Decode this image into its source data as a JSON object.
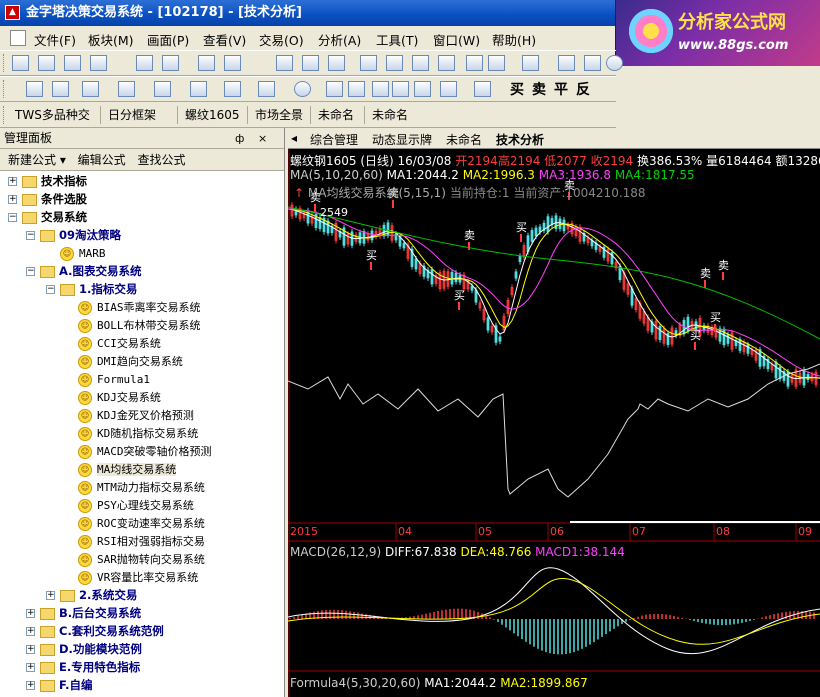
{
  "window": {
    "title": "金字塔决策交易系统 - [102178] - [技术分析]",
    "app_icon": "pyramid-icon"
  },
  "logo": {
    "name": "分析家公式网",
    "url": "www.88gs.com"
  },
  "menu": [
    "文件(F)",
    "板块(M)",
    "画面(P)",
    "查看(V)",
    "交易(O)",
    "分析(A)",
    "工具(T)",
    "窗口(W)",
    "帮助(H)"
  ],
  "toolbar2_text": [
    "买",
    "卖",
    "平",
    "反"
  ],
  "toolbar3_tabs": [
    "TWS多品种交",
    "日分框架",
    "螺纹1605",
    "市场全景",
    "未命名",
    "未命名"
  ],
  "panel": {
    "title": "管理面板",
    "pin": "ф",
    "close": "×",
    "tools": [
      "新建公式 ▾",
      "编辑公式",
      "查找公式"
    ],
    "tree": [
      {
        "level": 0,
        "exp": "+",
        "type": "folder",
        "label": "技术指标"
      },
      {
        "level": 0,
        "exp": "+",
        "type": "folder",
        "label": "条件选股"
      },
      {
        "level": 0,
        "exp": "−",
        "type": "folder",
        "label": "交易系统"
      },
      {
        "level": 1,
        "exp": "−",
        "type": "folder",
        "label": "09淘汰策略"
      },
      {
        "level": 2,
        "exp": "",
        "type": "face",
        "label": "MARB"
      },
      {
        "level": 1,
        "exp": "−",
        "type": "folder",
        "label": "A.图表交易系统"
      },
      {
        "level": 2,
        "exp": "−",
        "type": "folder",
        "label": "1.指标交易"
      },
      {
        "level": 3,
        "exp": "",
        "type": "face",
        "label": "BIAS乖离率交易系统"
      },
      {
        "level": 3,
        "exp": "",
        "type": "face",
        "label": "BOLL布林带交易系统"
      },
      {
        "level": 3,
        "exp": "",
        "type": "face",
        "label": "CCI交易系统"
      },
      {
        "level": 3,
        "exp": "",
        "type": "face",
        "label": "DMI趋向交易系统"
      },
      {
        "level": 3,
        "exp": "",
        "type": "face",
        "label": "Formula1"
      },
      {
        "level": 3,
        "exp": "",
        "type": "face",
        "label": "KDJ交易系统"
      },
      {
        "level": 3,
        "exp": "",
        "type": "face",
        "label": "KDJ金死叉价格预测"
      },
      {
        "level": 3,
        "exp": "",
        "type": "face",
        "label": "KD随机指标交易系统"
      },
      {
        "level": 3,
        "exp": "",
        "type": "face",
        "label": "MACD突破零轴价格预测"
      },
      {
        "level": 3,
        "exp": "",
        "type": "face",
        "label": "MA均线交易系统",
        "selected": true
      },
      {
        "level": 3,
        "exp": "",
        "type": "face",
        "label": "MTM动力指标交易系统"
      },
      {
        "level": 3,
        "exp": "",
        "type": "face",
        "label": "PSY心理线交易系统"
      },
      {
        "level": 3,
        "exp": "",
        "type": "face",
        "label": "ROC变动速率交易系统"
      },
      {
        "level": 3,
        "exp": "",
        "type": "face",
        "label": "RSI相对强弱指标交易"
      },
      {
        "level": 3,
        "exp": "",
        "type": "face",
        "label": "SAR抛物转向交易系统"
      },
      {
        "level": 3,
        "exp": "",
        "type": "face",
        "label": "VR容量比率交易系统"
      },
      {
        "level": 2,
        "exp": "+",
        "type": "folder",
        "label": "2.系统交易"
      },
      {
        "level": 1,
        "exp": "+",
        "type": "folder",
        "label": "B.后台交易系统"
      },
      {
        "level": 1,
        "exp": "+",
        "type": "folder",
        "label": "C.套利交易系统范例"
      },
      {
        "level": 1,
        "exp": "+",
        "type": "folder",
        "label": "D.功能模块范例"
      },
      {
        "level": 1,
        "exp": "+",
        "type": "folder",
        "label": "E.专用特色指标"
      },
      {
        "level": 1,
        "exp": "+",
        "type": "folder",
        "label": "F.自编"
      }
    ]
  },
  "doc_tabs": [
    {
      "label": "综合管理",
      "active": false
    },
    {
      "label": "动态显示牌",
      "active": false
    },
    {
      "label": "未命名",
      "active": false
    },
    {
      "label": "技术分析",
      "active": true
    }
  ],
  "chart": {
    "header": {
      "symbol": "螺纹钢1605 (日线) 16/03/08",
      "open": "开2194",
      "high": "高2194",
      "low": "低2077",
      "close": "收2194",
      "turnover": "换386.53%",
      "volume": "量6184464",
      "amount": "额13286"
    },
    "ma_line": {
      "label": "MA(5,10,20,60)",
      "ma1": "MA1:2044.2",
      "ma2": "MA2:1996.3",
      "ma3": "MA3:1936.8",
      "ma4": "MA4:1817.55"
    },
    "system_line": {
      "label": "MA均线交易系统(5,15,1)",
      "hold": "当前持仓:1",
      "asset": "当前资产:1004210.188"
    },
    "price_label": "2549",
    "x_labels": [
      "2015",
      "04",
      "05",
      "06",
      "07",
      "08",
      "09"
    ],
    "macd": {
      "label": "MACD(26,12,9)",
      "diff": "DIFF:67.838",
      "dea": "DEA:48.766",
      "macd1": "MACD1:38.144"
    },
    "formula": {
      "label": "Formula4(5,30,20,60)",
      "ma1": "MA1:2044.2",
      "ma2": "MA2:1899.867"
    },
    "colors": {
      "up": "#ff3c3c",
      "down": "#50e0e0",
      "ma1": "#ffffff",
      "ma2": "#ffff00",
      "ma3": "#ff40ff",
      "ma4": "#00c000"
    }
  }
}
